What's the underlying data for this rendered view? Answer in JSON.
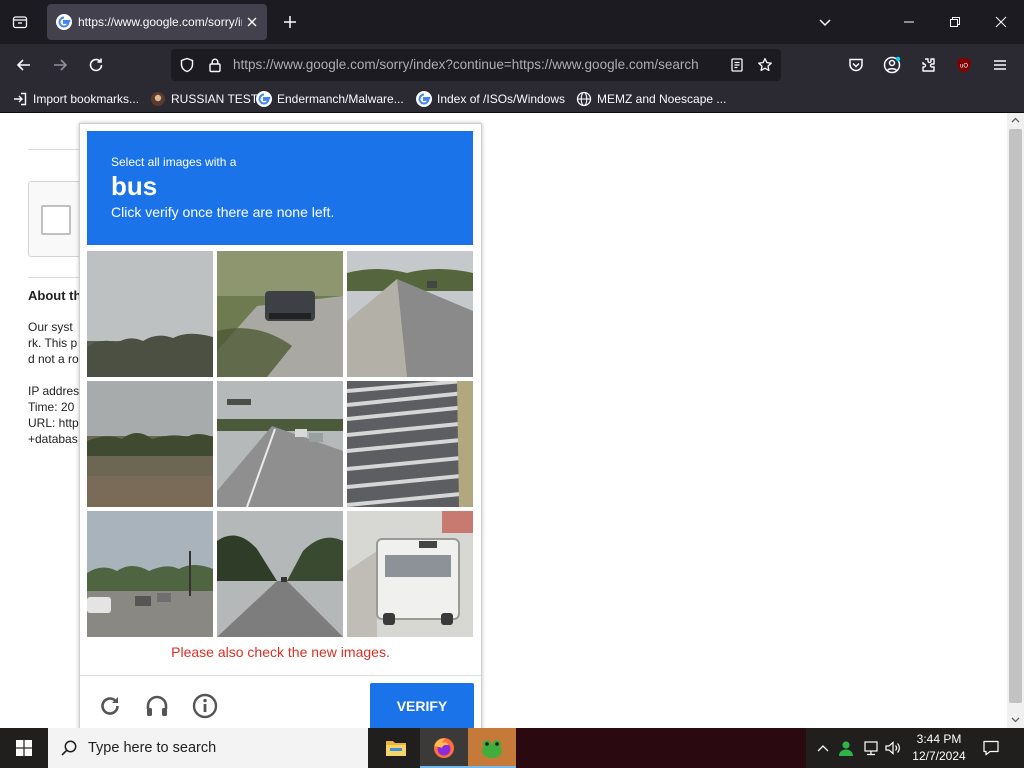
{
  "browser": {
    "tab": {
      "title": "https://www.google.com/sorry/index?continue=https://www.google.com/search"
    },
    "url": "https://www.google.com/sorry/index?continue=https://www.google.com/search",
    "bookmarks": [
      {
        "label": "Import bookmarks...",
        "icon": "import-icon"
      },
      {
        "label": "RUSSIAN TEST",
        "icon": "site-icon"
      },
      {
        "label": "Endermanch/Malware...",
        "icon": "google-icon"
      },
      {
        "label": "Index of /ISOs/Windows",
        "icon": "google-icon"
      },
      {
        "label": "MEMZ and Noescape ...",
        "icon": "globe-icon"
      }
    ]
  },
  "page": {
    "heading": "About th",
    "para_lines": [
      "Our syst",
      "rk. This p",
      "d not a ro"
    ],
    "info_lines": [
      "IP addres",
      "Time: 20",
      "URL: http",
      "+databas"
    ]
  },
  "captcha": {
    "instruction": "Select all images with a",
    "target": "bus",
    "subtext": "Click verify once there are none left.",
    "error": "Please also check the new images.",
    "verify_label": "VERIFY",
    "accent": "#1a73e8",
    "tiles": [
      {
        "scene": "sky-trees"
      },
      {
        "scene": "road-car"
      },
      {
        "scene": "highway"
      },
      {
        "scene": "field-trees"
      },
      {
        "scene": "highway-overpass"
      },
      {
        "scene": "crosswalk"
      },
      {
        "scene": "street-traffic"
      },
      {
        "scene": "road-trees"
      },
      {
        "scene": "bus"
      }
    ]
  },
  "taskbar": {
    "search_placeholder": "Type here to search",
    "time": "3:44 PM",
    "date": "12/7/2024"
  }
}
